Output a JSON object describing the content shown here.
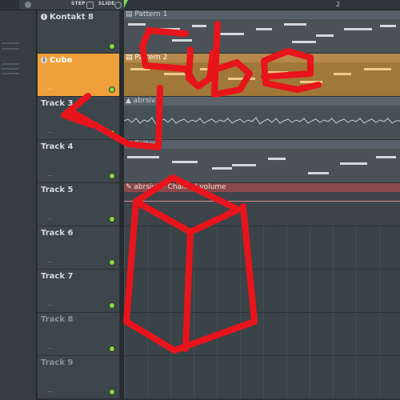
{
  "toolbar": {
    "step_label": "STEP",
    "slide_label": "SLIDE",
    "bar_number": "2"
  },
  "tracks": [
    {
      "name": "Kontakt 8",
      "dots": "",
      "selected": false,
      "dimmed": false,
      "info_icon": true
    },
    {
      "name": "Cube",
      "dots": "...",
      "selected": true,
      "dimmed": false,
      "info_icon": true
    },
    {
      "name": "Track 3",
      "dots": "...",
      "selected": false,
      "dimmed": false,
      "info_icon": false
    },
    {
      "name": "Track 4",
      "dots": "...",
      "selected": false,
      "dimmed": false,
      "info_icon": false
    },
    {
      "name": "Track 5",
      "dots": "...",
      "selected": false,
      "dimmed": false,
      "info_icon": false
    },
    {
      "name": "Track 6",
      "dots": "...",
      "selected": false,
      "dimmed": false,
      "info_icon": false
    },
    {
      "name": "Track 7",
      "dots": "...",
      "selected": false,
      "dimmed": false,
      "info_icon": false
    },
    {
      "name": "Track 8",
      "dots": "...",
      "selected": false,
      "dimmed": true,
      "info_icon": false
    },
    {
      "name": "Track 9",
      "dots": "...",
      "selected": false,
      "dimmed": true,
      "info_icon": false
    }
  ],
  "clips": {
    "pattern1": "Pattern 1",
    "pattern2": "Pattern 2",
    "audio": "abrsiv3",
    "pattern4": "Pattern",
    "automation": "abrsiv3 - Channel volume"
  },
  "annotation": {
    "handwritten_text": "Cube",
    "color": "#e8141b"
  },
  "colors": {
    "selected_track": "#f0a03a",
    "led_green": "#8bd64a",
    "automation_clip": "#8a4a4a"
  }
}
